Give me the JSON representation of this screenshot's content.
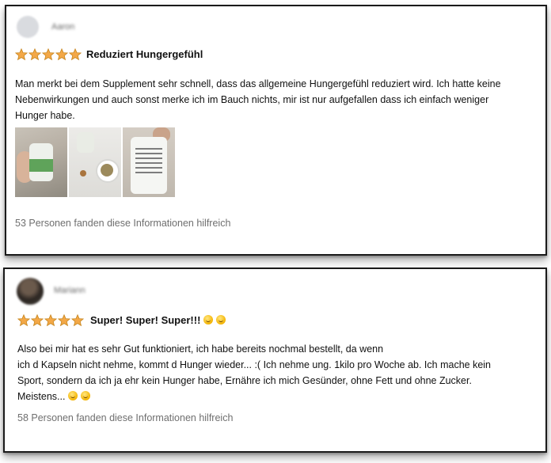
{
  "reviews": [
    {
      "username": "Aaron",
      "rating": 5,
      "max_rating": 5,
      "title": "Reduziert Hungergefühl",
      "body_lines": [
        "Man merkt bei dem Supplement sehr schnell, dass das allgemeine Hungergefühl reduziert wird. Ich hatte keine",
        "Nebenwirkungen und auch sonst merke ich im Bauch nichts, mir ist nur aufgefallen dass ich einfach weniger",
        "Hunger habe."
      ],
      "photos_count": 3,
      "helpful": "53 Personen fanden diese Informationen hilfreich"
    },
    {
      "username": "Mariann",
      "rating": 5,
      "max_rating": 5,
      "title": "Super! Super! Super!!!",
      "title_emojis": [
        "smile-emoji",
        "smile-emoji"
      ],
      "body_lines": [
        "Also bei mir hat es sehr Gut funktioniert, ich habe bereits nochmal bestellt, da wenn",
        "ich d Kapseln nicht nehme, kommt d Hunger wieder... :( Ich nehme ung. 1kilo pro Woche ab. Ich mache kein",
        "Sport, sondern da ich ja ehr kein Hunger habe, Ernähre ich mich Gesünder, ohne Fett und ohne Zucker.",
        "Meistens..."
      ],
      "body_emojis": [
        "smile-emoji",
        "wink-emoji"
      ],
      "helpful": "58 Personen fanden diese Informationen hilfreich"
    }
  ],
  "colors": {
    "star": "#f3a847",
    "star_edge": "#c7861f",
    "helpful_text": "#6f6f6f",
    "border": "#1a1a1a"
  }
}
